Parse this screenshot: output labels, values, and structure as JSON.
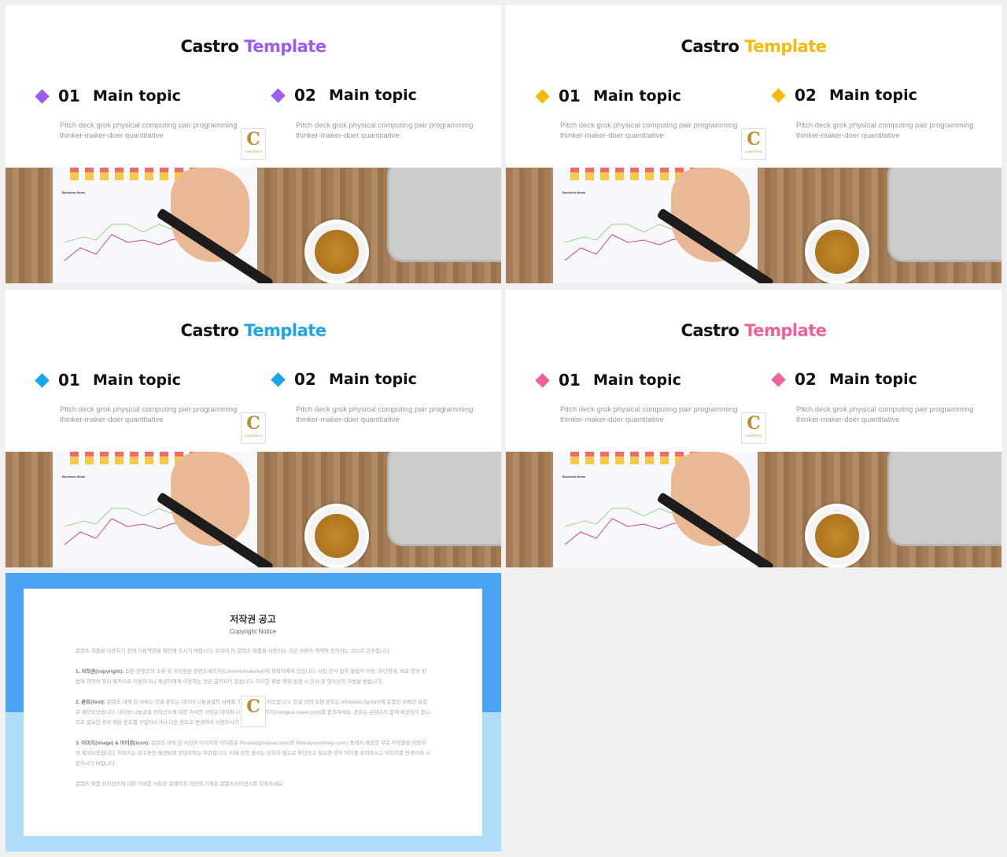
{
  "slides": [
    {
      "title": "Castro",
      "accent_word": "Template",
      "accent": "#9b5cf0",
      "topics": [
        {
          "num": "01",
          "label": "Main topic",
          "desc": "Pitch deck grok physical computing pair programming thinker-maker-doer  quantitative"
        },
        {
          "num": "02",
          "label": "Main topic",
          "desc": "Pitch deck grok physical computing pair programming thinker-maker-doer  quantitative"
        }
      ]
    },
    {
      "title": "Castro",
      "accent_word": "Template",
      "accent": "#f5bb0c",
      "topics": [
        {
          "num": "01",
          "label": "Main topic",
          "desc": "Pitch deck grok physical computing pair programming thinker-maker-doer  quantitative"
        },
        {
          "num": "02",
          "label": "Main topic",
          "desc": "Pitch deck grok physical computing pair programming thinker-maker-doer  quantitative"
        }
      ]
    },
    {
      "title": "Castro",
      "accent_word": "Template",
      "accent": "#1aa7e8",
      "topics": [
        {
          "num": "01",
          "label": "Main topic",
          "desc": "Pitch deck grok physical computing pair programming thinker-maker-doer  quantitative"
        },
        {
          "num": "02",
          "label": "Main topic",
          "desc": "Pitch deck grok physical computing pair programming thinker-maker-doer  quantitative"
        }
      ]
    },
    {
      "title": "Castro",
      "accent_word": "Template",
      "accent": "#f0609a",
      "topics": [
        {
          "num": "01",
          "label": "Main topic",
          "desc": "Pitch deck grok physical computing pair programming thinker-maker-doer  quantitative"
        },
        {
          "num": "02",
          "label": "Main topic",
          "desc": "Pitch deck grok physical computing pair programming thinker-maker-doer  quantitative"
        }
      ]
    }
  ],
  "logo": {
    "letter": "C",
    "text": "CONTENTS"
  },
  "photo_label": "Business Items",
  "copyright": {
    "title": "저작권 공고",
    "subtitle": "Copyright Notice",
    "intro": "콘텐츠 제품을 사용하기 전에 이용약관을 확인해 주시기 바랍니다. 위하여 이 콘텐츠 제품을 사용하는 것은 사용자 계약에 동의하는 것으로 간주됩니다.",
    "sections": [
      {
        "head": "1. 저작권(copyright):",
        "body": "모든 콘텐츠의 소유 및 저작권은 콘텐츠메이커(Contentsmakeout)에 제작자에게 있습니다. 사전 승낙 없이 불법적 이용, 무단전재, 배포 등의 방법에 의하여 영리 목적으로 이용하거나 제삼자에게 이용하는 것은 금지되어 있습니다. 이러한 불법 행위 발견 시 민사 및 형사상의 처벌을 받습니다."
      },
      {
        "head": "2. 폰트(font):",
        "body": "콘텐츠 내에 된 서체는 한글 폰트는 네이버 나눔글꼴의 서체를 이용하여 제작되었습니다. 한글 외의 보편 폰트는 Windows System에 포함된 서체의 글꼴로 제작되었습니다. 네이버 나눔글꼴 라이선스에 대한 자세한 사항은 네이버 나눔글꼴 홈페이지(hangeul.naver.com)를 참조하세요. 폰트는 콘텐츠의 함께 제공되지 않으므로 필요한 경우 해당 폰트를 구입하시거나 다른 폰트로 변경하여 사용하시기 바랍니다."
      },
      {
        "head": "3. 이미지(image) & 아이콘(icon):",
        "body": "콘텐츠 내에 된 사진과 이미지와 아이콘은 Pixabay(pixabay.com)와 Webalys(webalys.com) 등에서 제공한 무료 저작물을 이용하여 제작되었습니다. 이미지는 참고용만 제공되며 콘텐츠와는 무관합니다. 이에 관한 권리는 원저자 별도로 확인하고 필요한 경우 여기를 유의하시고 이미지를 변경하여 사용하시기 바랍니다."
      }
    ],
    "footer": "콘텐츠 제품 라이선스에 대한 자세한 사항은 홈페이지 하단에 기재된 콘텐츠라이선스를 참조하세요.",
    "top_color": "#4aa2f3",
    "bottom_color": "#aedcfb"
  }
}
